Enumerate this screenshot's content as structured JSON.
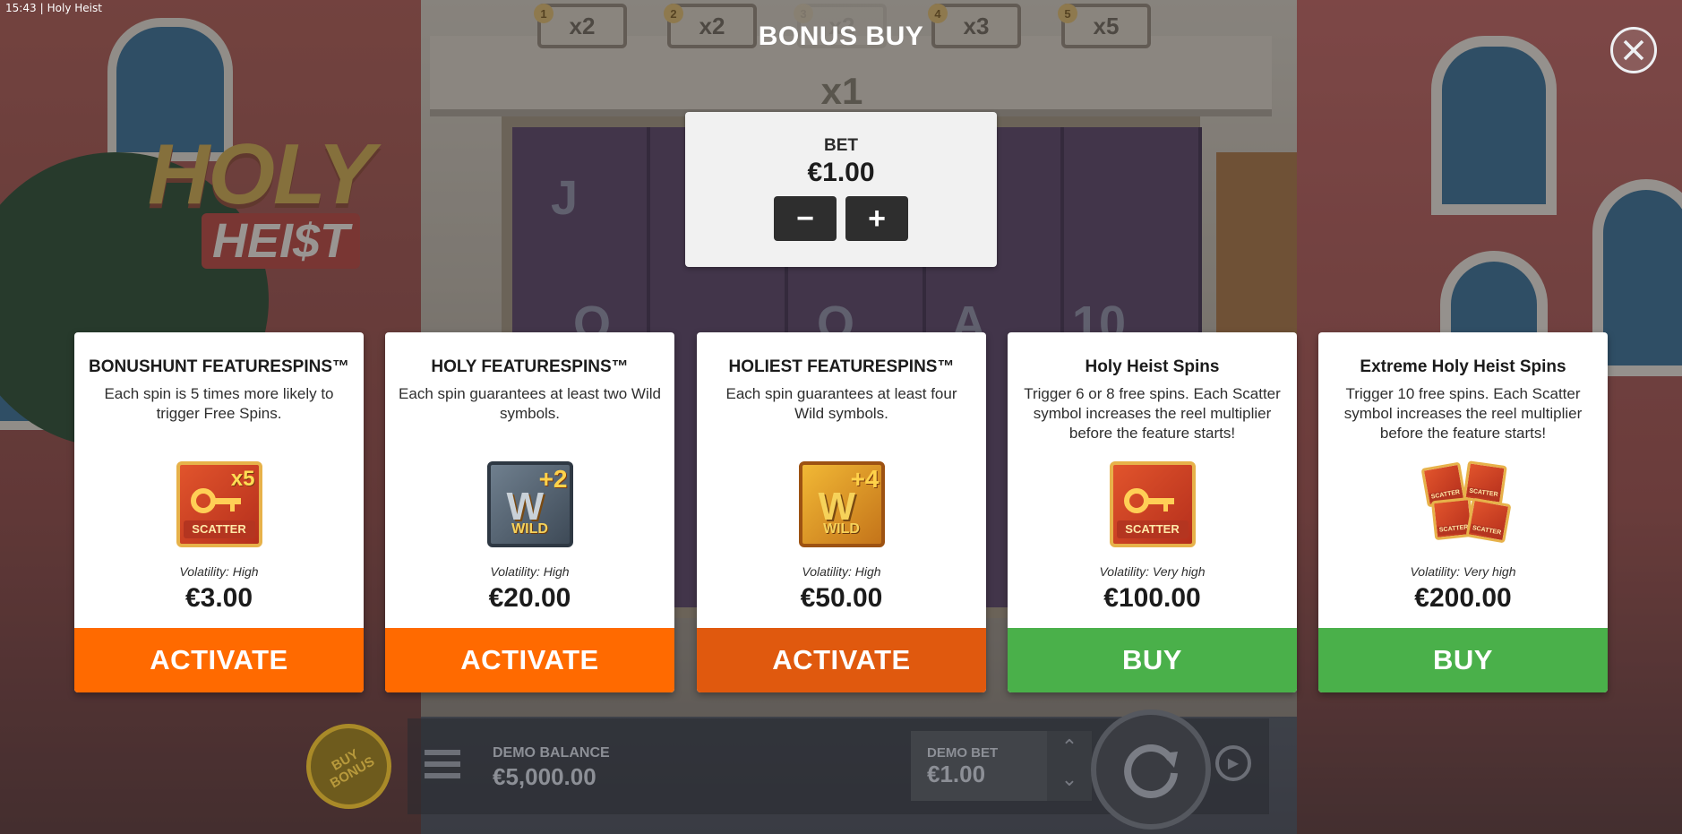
{
  "status_bar": {
    "time": "15:43",
    "app_name": "Holy Heist"
  },
  "game_bg": {
    "logo_line1": "HOLY",
    "logo_line2": "HEI$T",
    "multipliers": [
      {
        "num": "1",
        "label": "x2"
      },
      {
        "num": "2",
        "label": "x2"
      },
      {
        "num": "3",
        "label": "x2"
      },
      {
        "num": "4",
        "label": "x3"
      },
      {
        "num": "5",
        "label": "x5"
      }
    ],
    "main_multiplier": "x1",
    "reel_symbols": [
      "J",
      "Q",
      "Q",
      "A",
      "10"
    ]
  },
  "dialog": {
    "title": "BONUS BUY",
    "bet": {
      "label": "BET",
      "value": "€1.00",
      "minus": "−",
      "plus": "+"
    },
    "cards": [
      {
        "title": "BONUSHUNT FEATURESPINS™",
        "description": "Each spin is 5 times more likely to trigger Free Spins.",
        "icon": "scatter-x5-icon",
        "volatility": "Volatility: High",
        "price": "€3.00",
        "action": "ACTIVATE"
      },
      {
        "title": "HOLY FEATURESPINS™",
        "description": "Each spin guarantees at least two Wild symbols.",
        "icon": "wild-plus2-icon",
        "volatility": "Volatility: High",
        "price": "€20.00",
        "action": "ACTIVATE"
      },
      {
        "title": "HOLIEST FEATURESPINS™",
        "description": "Each spin guarantees at least four Wild symbols.",
        "icon": "wild-plus4-icon",
        "volatility": "Volatility: High",
        "price": "€50.00",
        "action": "ACTIVATE"
      },
      {
        "title": "Holy Heist Spins",
        "description": "Trigger 6 or 8 free spins. Each Scatter symbol increases the reel multiplier before the feature starts!",
        "icon": "scatter-icon",
        "volatility": "Volatility: Very high",
        "price": "€100.00",
        "action": "BUY"
      },
      {
        "title": "Extreme Holy Heist Spins",
        "description": "Trigger 10 free spins. Each Scatter symbol increases the reel multiplier before the feature starts!",
        "icon": "scatter-stack-icon",
        "volatility": "Volatility: Very high",
        "price": "€200.00",
        "action": "BUY"
      }
    ],
    "symbol_text": {
      "scatter": "SCATTER",
      "wild": "WILD",
      "x5": "x5",
      "w": "W",
      "plus2": "+2",
      "plus4": "+4"
    }
  },
  "bottom_bar": {
    "buy_bonus": "BUY BONUS",
    "balance_label": "DEMO BALANCE",
    "balance_value": "€5,000.00",
    "bet_label": "DEMO BET",
    "bet_value": "€1.00"
  },
  "colors": {
    "activate": "#ff6a00",
    "activate_dark": "#e0590e",
    "buy": "#4ab04a",
    "card_bg": "#ffffff",
    "panel_bg": "#f1f1f1"
  }
}
